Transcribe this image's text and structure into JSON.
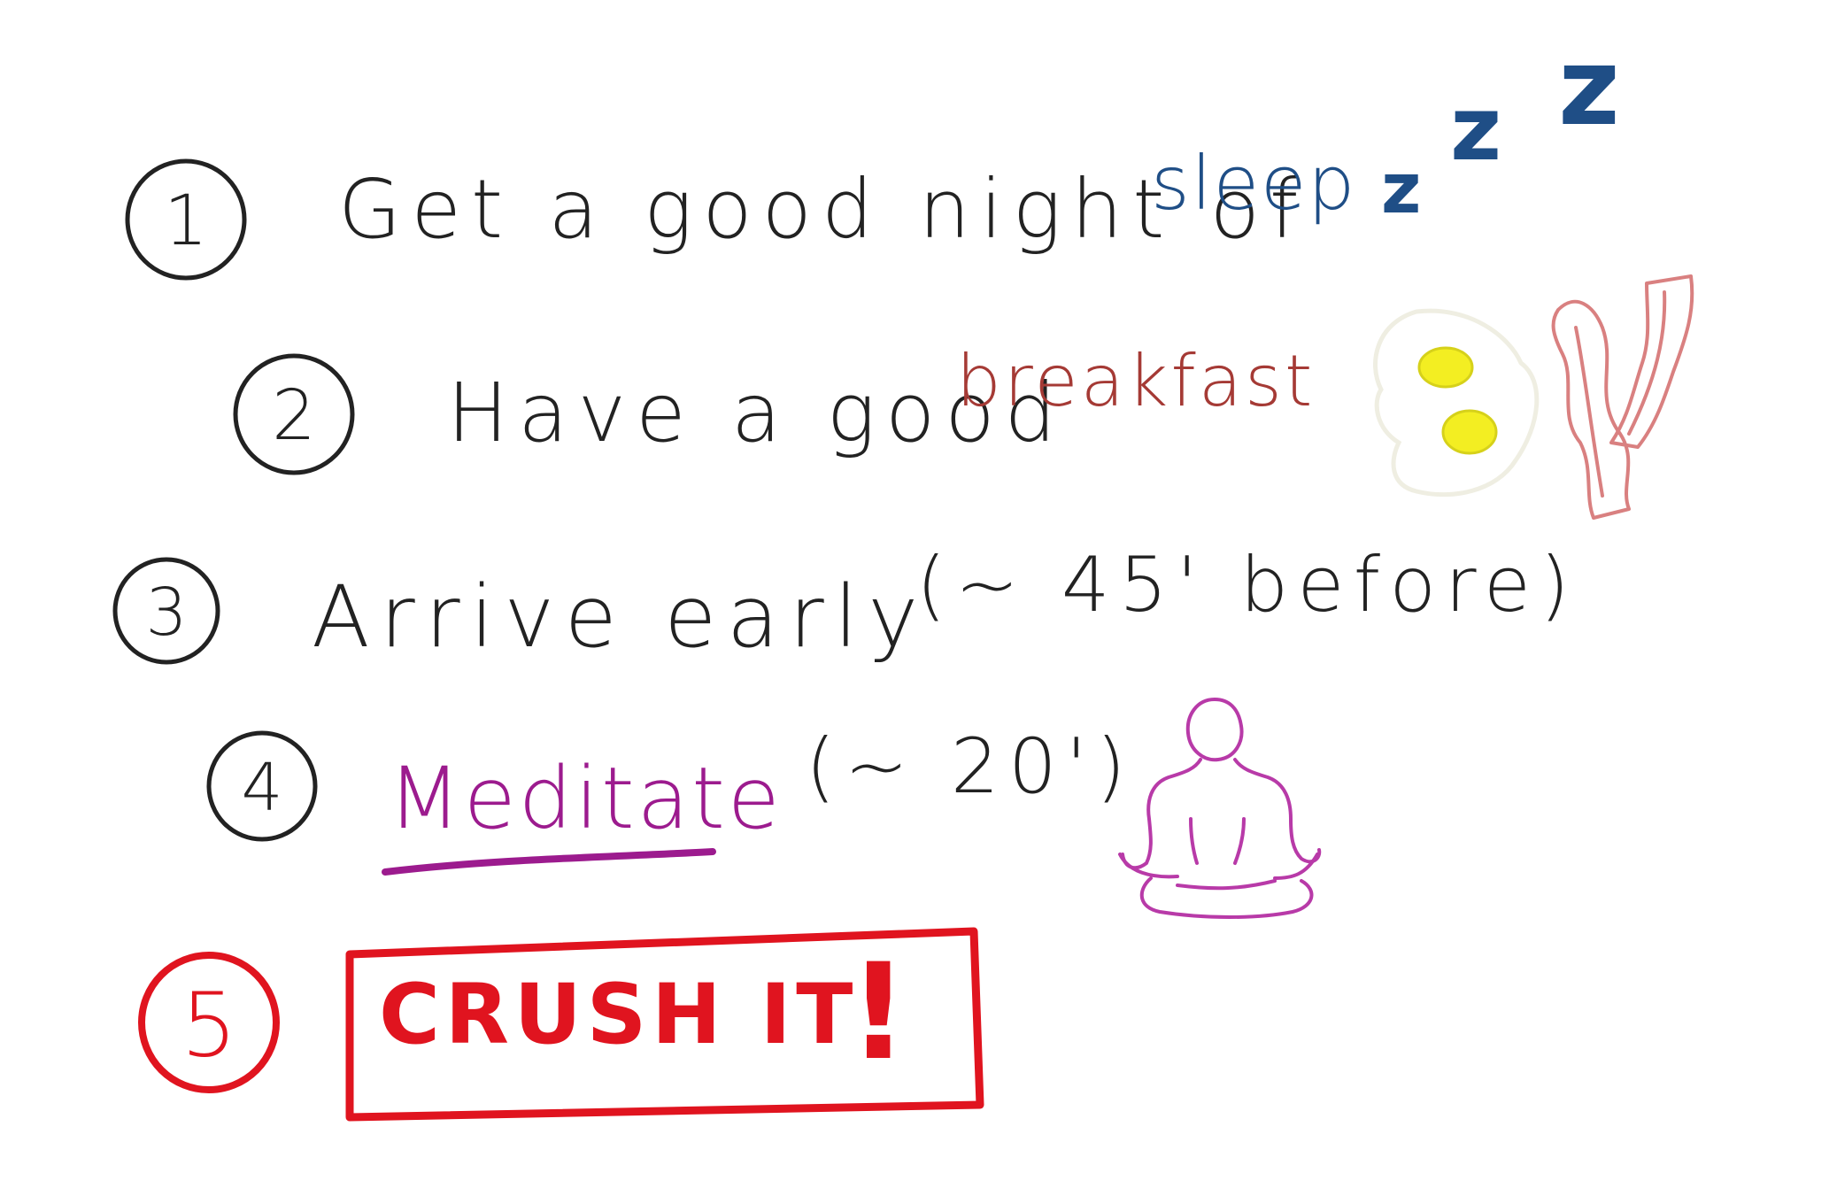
{
  "colors": {
    "ink": "#222222",
    "sleep": "#1f4e86",
    "breakfast": "#a53a35",
    "meditate": "#9c1b8e",
    "crush": "#e0141f",
    "egg_white": "#efeee2",
    "yolk": "#f3ee22",
    "bacon": "#d98080"
  },
  "steps": [
    {
      "number": "1",
      "text": "Get a good night of",
      "highlight": "sleep",
      "extra": "z",
      "extra2": "z",
      "extra3": "z"
    },
    {
      "number": "2",
      "text": "Have a good",
      "highlight": "breakfast"
    },
    {
      "number": "3",
      "text": "Arrive early",
      "note": "(~ 45' before)"
    },
    {
      "number": "4",
      "highlight": "Meditate",
      "note": "(~ 20')"
    },
    {
      "number": "5",
      "highlight": "CRUSH IT",
      "mark": "!"
    }
  ],
  "icons": {
    "sleep": "zzz-sleep-icon",
    "eggs": "fried-eggs-icon",
    "bacon": "bacon-icon",
    "meditation": "meditating-person-icon"
  }
}
